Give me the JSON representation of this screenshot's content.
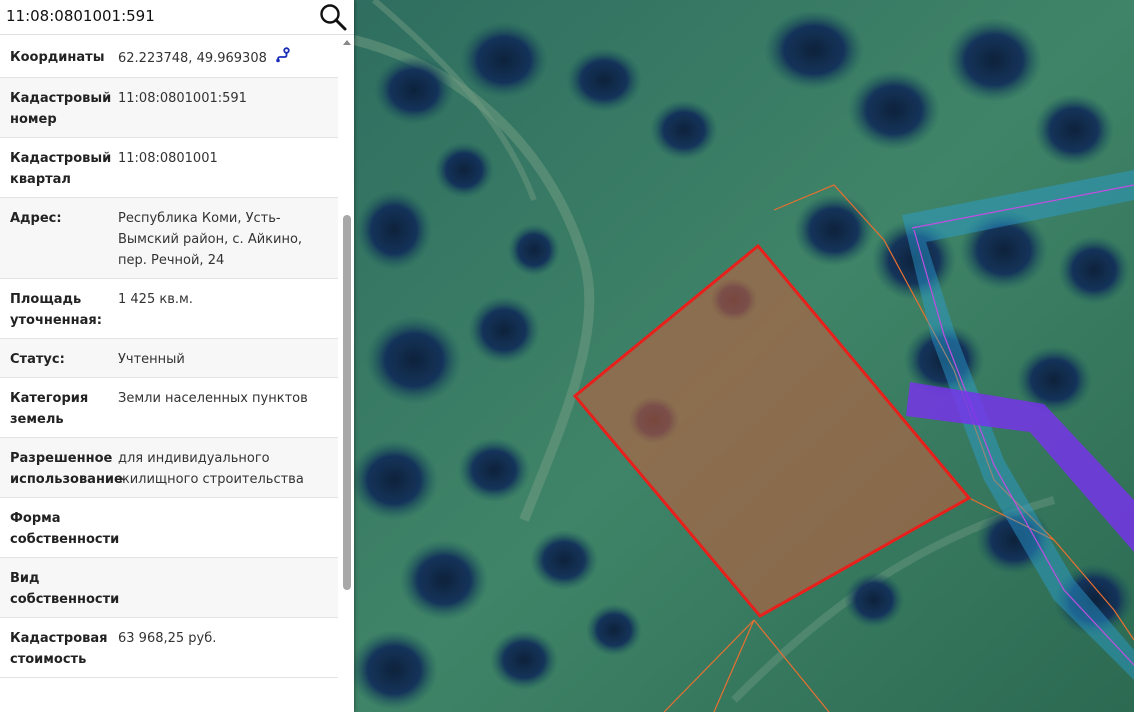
{
  "search": {
    "value": "11:08:0801001:591"
  },
  "parcel": {
    "rows": [
      {
        "key": "Координаты",
        "value": "62.223748, 49.969308"
      },
      {
        "key": "Кадастровый номер",
        "value": "11:08:0801001:591"
      },
      {
        "key": "Кадастровый квартал",
        "value": "11:08:0801001"
      },
      {
        "key": "Адрес:",
        "value": "Республика Коми, Усть-Вымский район, с. Айкино, пер. Речной, 24"
      },
      {
        "key": "Площадь уточненная:",
        "value": "1 425 кв.м."
      },
      {
        "key": "Статус:",
        "value": "Учтенный"
      },
      {
        "key": "Категория земель",
        "value": "Земли населенных пунктов"
      },
      {
        "key": "Разрешенное использование",
        "value": "для индивидуального жилищного строительства"
      },
      {
        "key": "Форма собственности",
        "value": ""
      },
      {
        "key": "Вид собственности",
        "value": ""
      },
      {
        "key": "Кадастровая стоимость",
        "value": "63 968,25 руб."
      }
    ]
  },
  "icons": {
    "search": "search-icon",
    "route": "route-icon"
  },
  "colors": {
    "parcel_border": "#e8201c",
    "parcel_fill": "#c0603f",
    "zone_cyan": "#2a9fd8",
    "zone_purple": "#7a2ff0",
    "boundary_orange": "#e87030"
  }
}
